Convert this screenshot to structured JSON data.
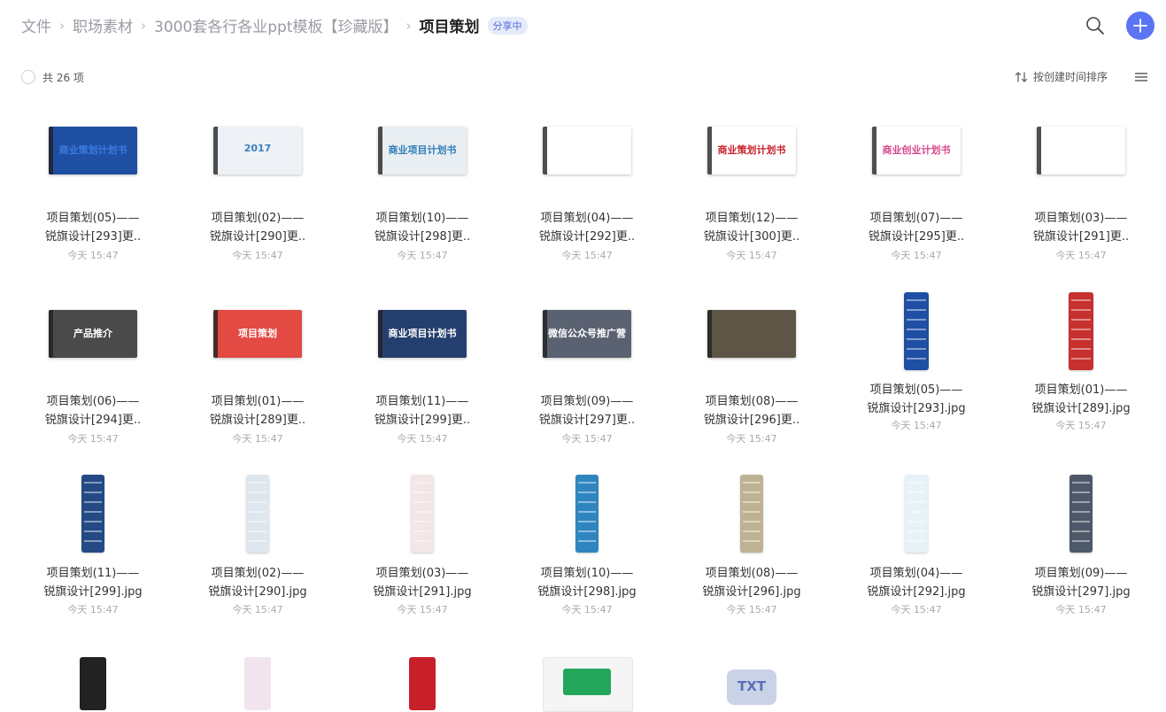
{
  "breadcrumb": {
    "items": [
      "文件",
      "职场素材",
      "3000套各行各业ppt模板【珍藏版】"
    ],
    "current": "项目策划",
    "badge": "分享中"
  },
  "toolbar": {
    "count": "共 26 项",
    "sort_label": "按创建时间排序"
  },
  "time_label": "今天 15:47",
  "files": [
    {
      "line1": "项目策划(05)——",
      "line2": "锐旗设计[293]更..",
      "kind": "wide",
      "color": "#1e4fa3",
      "accent": "#3b7be0",
      "text": "商业策划计划书"
    },
    {
      "line1": "项目策划(02)——",
      "line2": "锐旗设计[290]更..",
      "kind": "wide",
      "color": "#eef2f6",
      "accent": "#3c7fc2",
      "text": "2017"
    },
    {
      "line1": "项目策划(10)——",
      "line2": "锐旗设计[298]更..",
      "kind": "wide",
      "color": "#e9eef2",
      "accent": "#2f7fb8",
      "text": "商业项目计划书"
    },
    {
      "line1": "项目策划(04)——",
      "line2": "锐旗设计[292]更..",
      "kind": "wide",
      "color": "#ffffff",
      "accent": "#2a8fd0",
      "text": ""
    },
    {
      "line1": "项目策划(12)——",
      "line2": "锐旗设计[300]更..",
      "kind": "wide",
      "color": "#ffffff",
      "accent": "#c8202a",
      "text": "商业策划计划书"
    },
    {
      "line1": "项目策划(07)——",
      "line2": "锐旗设计[295]更..",
      "kind": "wide",
      "color": "#ffffff",
      "accent": "#d9478a",
      "text": "商业创业计划书"
    },
    {
      "line1": "项目策划(03)——",
      "line2": "锐旗设计[291]更..",
      "kind": "wide",
      "color": "#ffffff",
      "accent": "#c3232b",
      "text": ""
    },
    {
      "line1": "项目策划(06)——",
      "line2": "锐旗设计[294]更..",
      "kind": "wide",
      "color": "#4a4a4a",
      "accent": "#ffffff",
      "text": "产品推介"
    },
    {
      "line1": "项目策划(01)——",
      "line2": "锐旗设计[289]更..",
      "kind": "wide",
      "color": "#e34a43",
      "accent": "#ffffff",
      "text": "项目策划"
    },
    {
      "line1": "项目策划(11)——",
      "line2": "锐旗设计[299]更..",
      "kind": "wide",
      "color": "#243f6e",
      "accent": "#ffffff",
      "text": "商业项目计划书"
    },
    {
      "line1": "项目策划(09)——",
      "line2": "锐旗设计[297]更..",
      "kind": "wide",
      "color": "#5a6170",
      "accent": "#ffffff",
      "text": "微信公众号推广营销"
    },
    {
      "line1": "项目策划(08)——",
      "line2": "锐旗设计[296]更..",
      "kind": "wide",
      "color": "#5d5545",
      "accent": "#d8c9a6",
      "text": ""
    },
    {
      "line1": "项目策划(05)——",
      "line2": "锐旗设计[293].jpg",
      "kind": "tall",
      "color": "#1e4fa3"
    },
    {
      "line1": "项目策划(01)——",
      "line2": "锐旗设计[289].jpg",
      "kind": "tall",
      "color": "#c6302f"
    },
    {
      "line1": "项目策划(11)——",
      "line2": "锐旗设计[299].jpg",
      "kind": "tall",
      "color": "#244a86"
    },
    {
      "line1": "项目策划(02)——",
      "line2": "锐旗设计[290].jpg",
      "kind": "tall",
      "color": "#dfe7ee"
    },
    {
      "line1": "项目策划(03)——",
      "line2": "锐旗设计[291].jpg",
      "kind": "tall",
      "color": "#f3e6e6"
    },
    {
      "line1": "项目策划(10)——",
      "line2": "锐旗设计[298].jpg",
      "kind": "tall",
      "color": "#2f86bf"
    },
    {
      "line1": "项目策划(08)——",
      "line2": "锐旗设计[296].jpg",
      "kind": "tall",
      "color": "#bfb294"
    },
    {
      "line1": "项目策划(04)——",
      "line2": "锐旗设计[292].jpg",
      "kind": "tall",
      "color": "#e7f1f8"
    },
    {
      "line1": "项目策划(09)——",
      "line2": "锐旗设计[297].jpg",
      "kind": "tall",
      "color": "#4d5868"
    },
    {
      "line1": "",
      "line2": "",
      "kind": "partial",
      "color": "#222222"
    },
    {
      "line1": "",
      "line2": "",
      "kind": "partial",
      "color": "#f1e4ee"
    },
    {
      "line1": "",
      "line2": "",
      "kind": "partial",
      "color": "#c8202a"
    },
    {
      "line1": "",
      "line2": "",
      "kind": "partial",
      "color": "#22a65a"
    },
    {
      "line1": "",
      "line2": "",
      "kind": "partial",
      "color": "#c9d2e6",
      "text": "TXT"
    }
  ]
}
